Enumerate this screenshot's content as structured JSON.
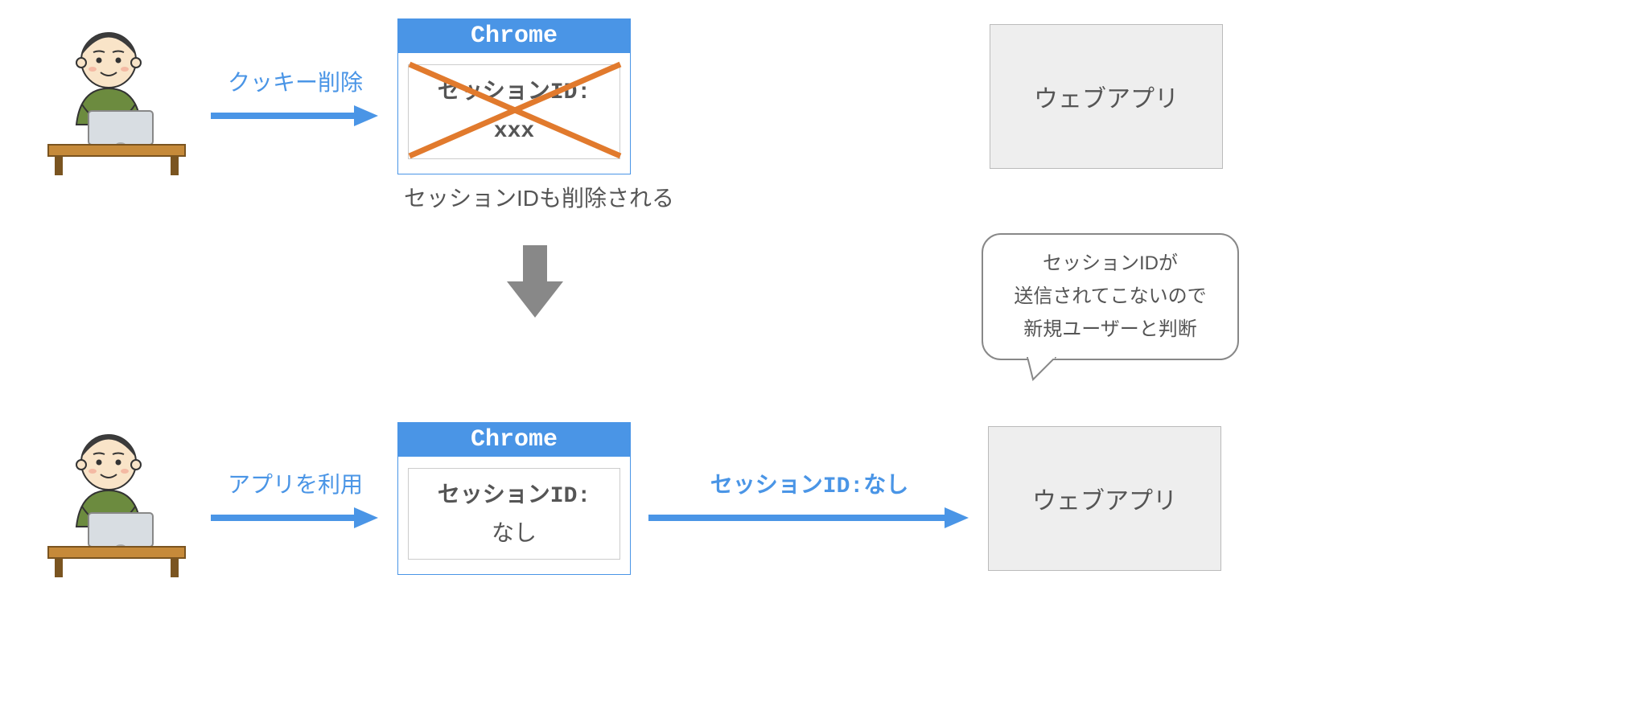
{
  "row1": {
    "arrow_label": "クッキー削除",
    "browser_title": "Chrome",
    "session_label": "セッションID:",
    "session_value": "xxx",
    "caption": "セッションIDも削除される",
    "webapp_label": "ウェブアプリ"
  },
  "row2": {
    "arrow_label": "アプリを利用",
    "browser_title": "Chrome",
    "session_label": "セッションID:",
    "session_value": "なし",
    "arrow2_label": "セッションID:なし",
    "webapp_label": "ウェブアプリ",
    "speech_line1": "セッションIDが",
    "speech_line2": "送信されてこないので",
    "speech_line3": "新規ユーザーと判断"
  },
  "colors": {
    "accent": "#4a95e6",
    "cross": "#e17a2d",
    "box_border": "#bbbbbb",
    "box_bg": "#eeeeee",
    "text_gray": "#555555"
  }
}
